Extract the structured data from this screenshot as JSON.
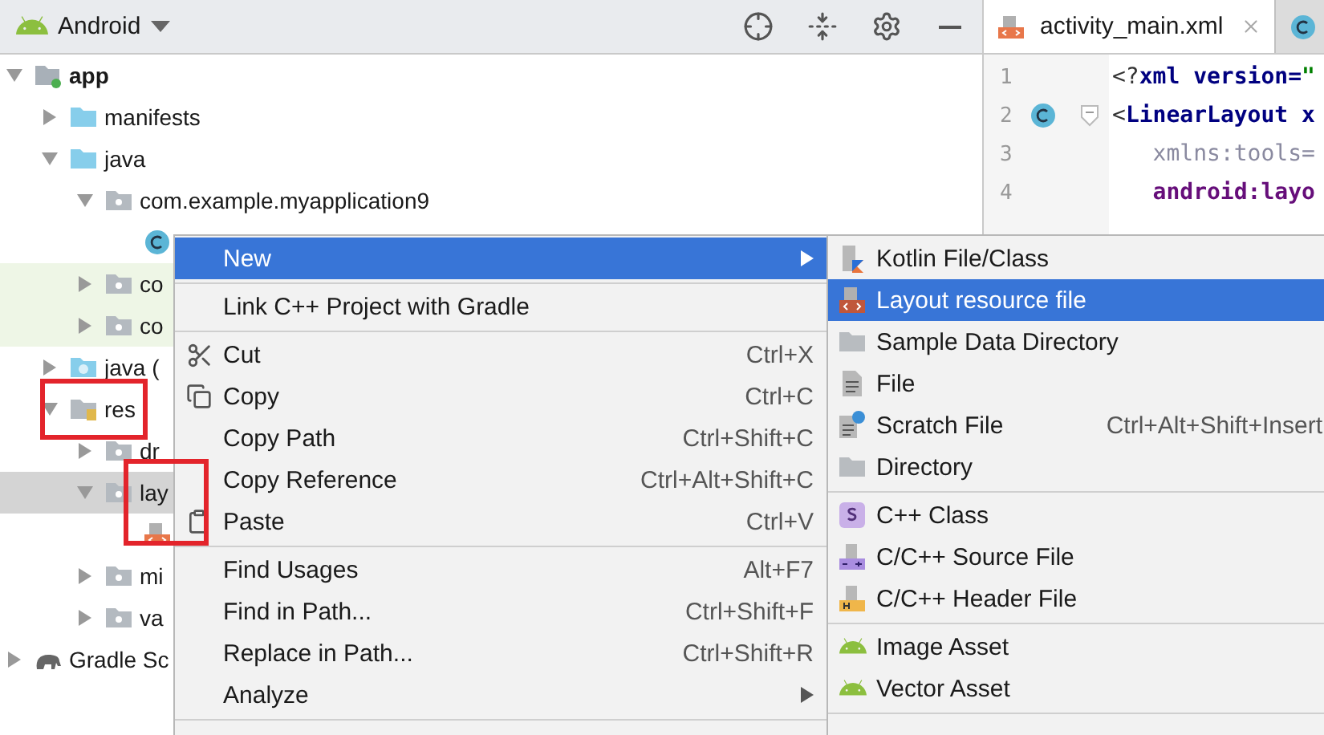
{
  "project_view": {
    "title": "Android"
  },
  "tree": [
    {
      "label": "app",
      "kind": "module",
      "bold": true,
      "expanded": true,
      "selected": false,
      "children": [
        {
          "label": "manifests",
          "kind": "folder",
          "expanded": false,
          "selected": false
        },
        {
          "label": "java",
          "kind": "folder",
          "expanded": true,
          "selected": false,
          "children": [
            {
              "label": "com.example.myapplication9",
              "kind": "package",
              "expanded": true,
              "selected": false,
              "children": [
                {
                  "kind": "class",
                  "selected": false
                }
              ]
            },
            {
              "label": "co",
              "kind": "package",
              "expanded": false,
              "selected": false,
              "test": true
            },
            {
              "label": "co",
              "kind": "package",
              "expanded": false,
              "selected": false,
              "test": true
            }
          ]
        },
        {
          "label": "java (",
          "kind": "generated",
          "expanded": false,
          "selected": false
        },
        {
          "label": "res",
          "kind": "res",
          "expanded": true,
          "selected": false,
          "highlighted": true,
          "children": [
            {
              "label": "dr",
              "kind": "package",
              "expanded": false,
              "selected": false
            },
            {
              "label": "lay",
              "kind": "package",
              "expanded": true,
              "selected": true,
              "highlighted": true,
              "children": [
                {
                  "kind": "layout",
                  "selected": false
                }
              ]
            },
            {
              "label": "mi",
              "kind": "package",
              "expanded": false,
              "selected": false
            },
            {
              "label": "va",
              "kind": "package",
              "expanded": false,
              "selected": false
            }
          ]
        }
      ]
    },
    {
      "label": "Gradle Sc",
      "kind": "gradle",
      "expanded": false,
      "selected": false
    }
  ],
  "editor": {
    "tabs": [
      {
        "label": "activity_main.xml",
        "kind": "layout",
        "selected": true,
        "closable": true
      },
      {
        "kind": "class",
        "selected": false
      }
    ],
    "lines": [
      {
        "number": "1",
        "kind": "plain",
        "tokens": [
          {
            "kind": "punct",
            "text": "<?"
          },
          {
            "kind": "tag",
            "text": "xml version="
          },
          {
            "kind": "string",
            "text": "\""
          }
        ]
      },
      {
        "number": "2",
        "kind": "class-marker",
        "fold": true,
        "tokens": [
          {
            "kind": "punct",
            "text": "<"
          },
          {
            "kind": "tag",
            "text": "LinearLayout x"
          }
        ]
      },
      {
        "number": "3",
        "kind": "plain",
        "tokens": [
          {
            "kind": "ns",
            "text": "   xmlns:tools="
          }
        ]
      },
      {
        "number": "4",
        "kind": "plain",
        "tokens": [
          {
            "kind": "attr",
            "text": "   android:layo"
          }
        ]
      }
    ]
  },
  "context_menu": {
    "items": [
      {
        "kind": "plain",
        "label": "New",
        "submenu": true,
        "selected": true
      },
      {
        "kind": "separator"
      },
      {
        "kind": "plain",
        "label": "Link C++ Project with Gradle",
        "selected": false
      },
      {
        "kind": "separator"
      },
      {
        "kind": "scissors",
        "label": "Cut",
        "shortcut": "Ctrl+X",
        "selected": false
      },
      {
        "kind": "copy",
        "label": "Copy",
        "shortcut": "Ctrl+C",
        "selected": false
      },
      {
        "kind": "plain",
        "label": "Copy Path",
        "shortcut": "Ctrl+Shift+C",
        "selected": false
      },
      {
        "kind": "plain",
        "label": "Copy Reference",
        "shortcut": "Ctrl+Alt+Shift+C",
        "selected": false
      },
      {
        "kind": "clipboard",
        "label": "Paste",
        "shortcut": "Ctrl+V",
        "selected": false
      },
      {
        "kind": "separator"
      },
      {
        "kind": "plain",
        "label": "Find Usages",
        "shortcut": "Alt+F7",
        "selected": false
      },
      {
        "kind": "plain",
        "label": "Find in Path...",
        "shortcut": "Ctrl+Shift+F",
        "selected": false
      },
      {
        "kind": "plain",
        "label": "Replace in Path...",
        "shortcut": "Ctrl+Shift+R",
        "selected": false
      },
      {
        "kind": "plain",
        "label": "Analyze",
        "submenu": true,
        "selected": false
      },
      {
        "kind": "separator"
      }
    ]
  },
  "new_submenu": {
    "items": [
      {
        "kind": "kotlin",
        "label": "Kotlin File/Class",
        "selected": false
      },
      {
        "kind": "layout",
        "label": "Layout resource file",
        "selected": true
      },
      {
        "kind": "folder",
        "label": "Sample Data Directory",
        "selected": false
      },
      {
        "kind": "file",
        "label": "File",
        "selected": false
      },
      {
        "kind": "scratch",
        "label": "Scratch File",
        "shortcut": "Ctrl+Alt+Shift+Insert",
        "selected": false
      },
      {
        "kind": "folder",
        "label": "Directory",
        "selected": false
      },
      {
        "kind": "separator"
      },
      {
        "kind": "cppclass",
        "label": "C++ Class",
        "selected": false
      },
      {
        "kind": "cppsource",
        "label": "C/C++ Source File",
        "selected": false
      },
      {
        "kind": "cppheader",
        "label": "C/C++ Header File",
        "selected": false
      },
      {
        "kind": "separator"
      },
      {
        "kind": "android",
        "label": "Image Asset",
        "selected": false
      },
      {
        "kind": "android",
        "label": "Vector Asset",
        "selected": false
      },
      {
        "kind": "separator"
      }
    ]
  }
}
